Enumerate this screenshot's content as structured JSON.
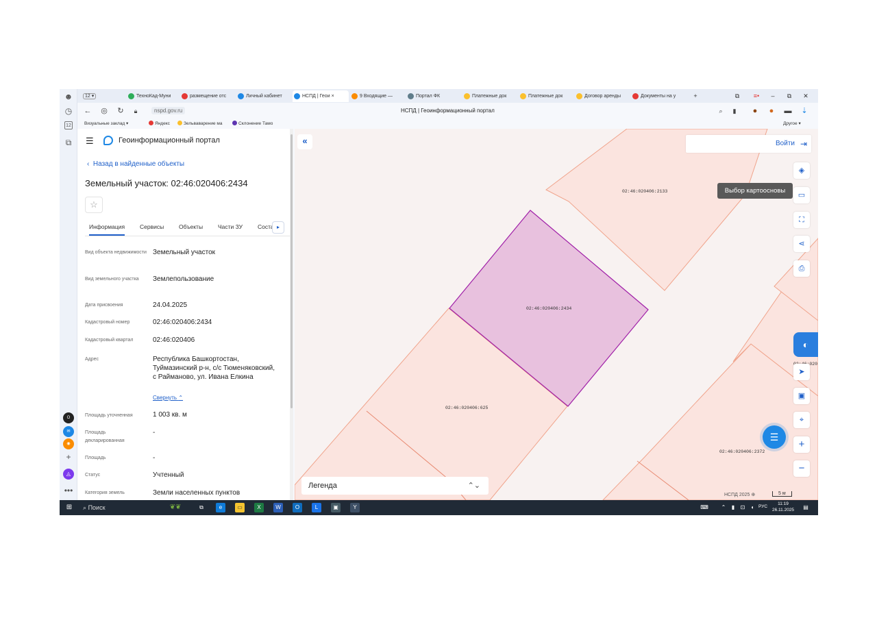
{
  "browser": {
    "tabs": [
      {
        "label": "ТехноКад-Муни",
        "color": "#2fae5a",
        "active": false
      },
      {
        "label": "размещение отс",
        "color": "#e53935",
        "active": false
      },
      {
        "label": "Личный кабинет",
        "color": "#1e88e5",
        "active": false
      },
      {
        "label": "НСПД | Геои",
        "color": "#1e88e5",
        "active": true
      },
      {
        "label": "9 Входящие —",
        "color": "#fb8c00",
        "active": false
      },
      {
        "label": "Портал ФК",
        "color": "#607d8b",
        "active": false
      },
      {
        "label": "Платежные док",
        "color": "#fbc02d",
        "active": false
      },
      {
        "label": "Платежные док",
        "color": "#fbc02d",
        "active": false
      },
      {
        "label": "Договор аренды",
        "color": "#fbc02d",
        "active": false
      },
      {
        "label": "Документы на у",
        "color": "#e53935",
        "active": false
      }
    ],
    "tab_close": "×",
    "new_tab": "+",
    "url": "nspd.gov.ru",
    "page_title": "НСПД | Геоинформационный портал",
    "bookmarks": [
      {
        "label": "Визуальные заклад",
        "color": "#9e9e9e"
      },
      {
        "label": "Яндекс",
        "color": "#e53935"
      },
      {
        "label": "Зельваварение ма",
        "color": "#fbc02d"
      },
      {
        "label": "Склонение Тамо",
        "color": "#5e35b1"
      }
    ],
    "other_bookmarks": "Другое"
  },
  "panel": {
    "portal_title": "Геоинформационный портал",
    "back_link": "Назад в найденные объекты",
    "object_title": "Земельный участок: 02:46:020406:2434",
    "tabs": [
      "Информация",
      "Сервисы",
      "Объекты",
      "Части ЗУ",
      "Соста"
    ],
    "fields": [
      {
        "label": "Вид объекта недвижимости",
        "value": "Земельный участок"
      },
      {
        "label": "Вид земельного участка",
        "value": "Землепользование"
      },
      {
        "label": "Дата присвоения",
        "value": "24.04.2025"
      },
      {
        "label": "Кадастровый номер",
        "value": "02:46:020406:2434"
      },
      {
        "label": "Кадастровый квартал",
        "value": "02:46:020406"
      },
      {
        "label": "Адрес",
        "value": "Республика Башкортостан, Туймазинский р-н, с/с Тюменяковский, с Райманово, ул. Ивана Елкина"
      },
      {
        "label": "Площадь уточненная",
        "value": "1 003 кв. м"
      },
      {
        "label": "Площадь декларированная",
        "value": "-"
      },
      {
        "label": "Площадь",
        "value": "-"
      },
      {
        "label": "Статус",
        "value": "Учтенный"
      },
      {
        "label": "Категория земель",
        "value": "Земли населенных пунктов"
      }
    ],
    "collapse_link": "Свернуть"
  },
  "map": {
    "login_label": "Войти",
    "tooltip": "Выбор картоосновы",
    "legend_label": "Легенда",
    "copyright": "НСПД 2025",
    "scale_label": "5 м",
    "parcels": [
      {
        "number": "02:46:020406:2133"
      },
      {
        "number": "02:46:020406:2434"
      },
      {
        "number": "02:46:020406:625"
      },
      {
        "number": "02:46:020406:2372"
      },
      {
        "number": "02:46:020"
      }
    ],
    "colors": {
      "selected_fill": "#e8c1de",
      "selected_stroke": "#a020a8",
      "parcel_fill": "#fbe4df",
      "parcel_stroke": "#f0a48c"
    }
  },
  "taskbar": {
    "search_label": "Поиск",
    "lang": "РУС",
    "time": "11:19",
    "date": "26.11.2025"
  }
}
